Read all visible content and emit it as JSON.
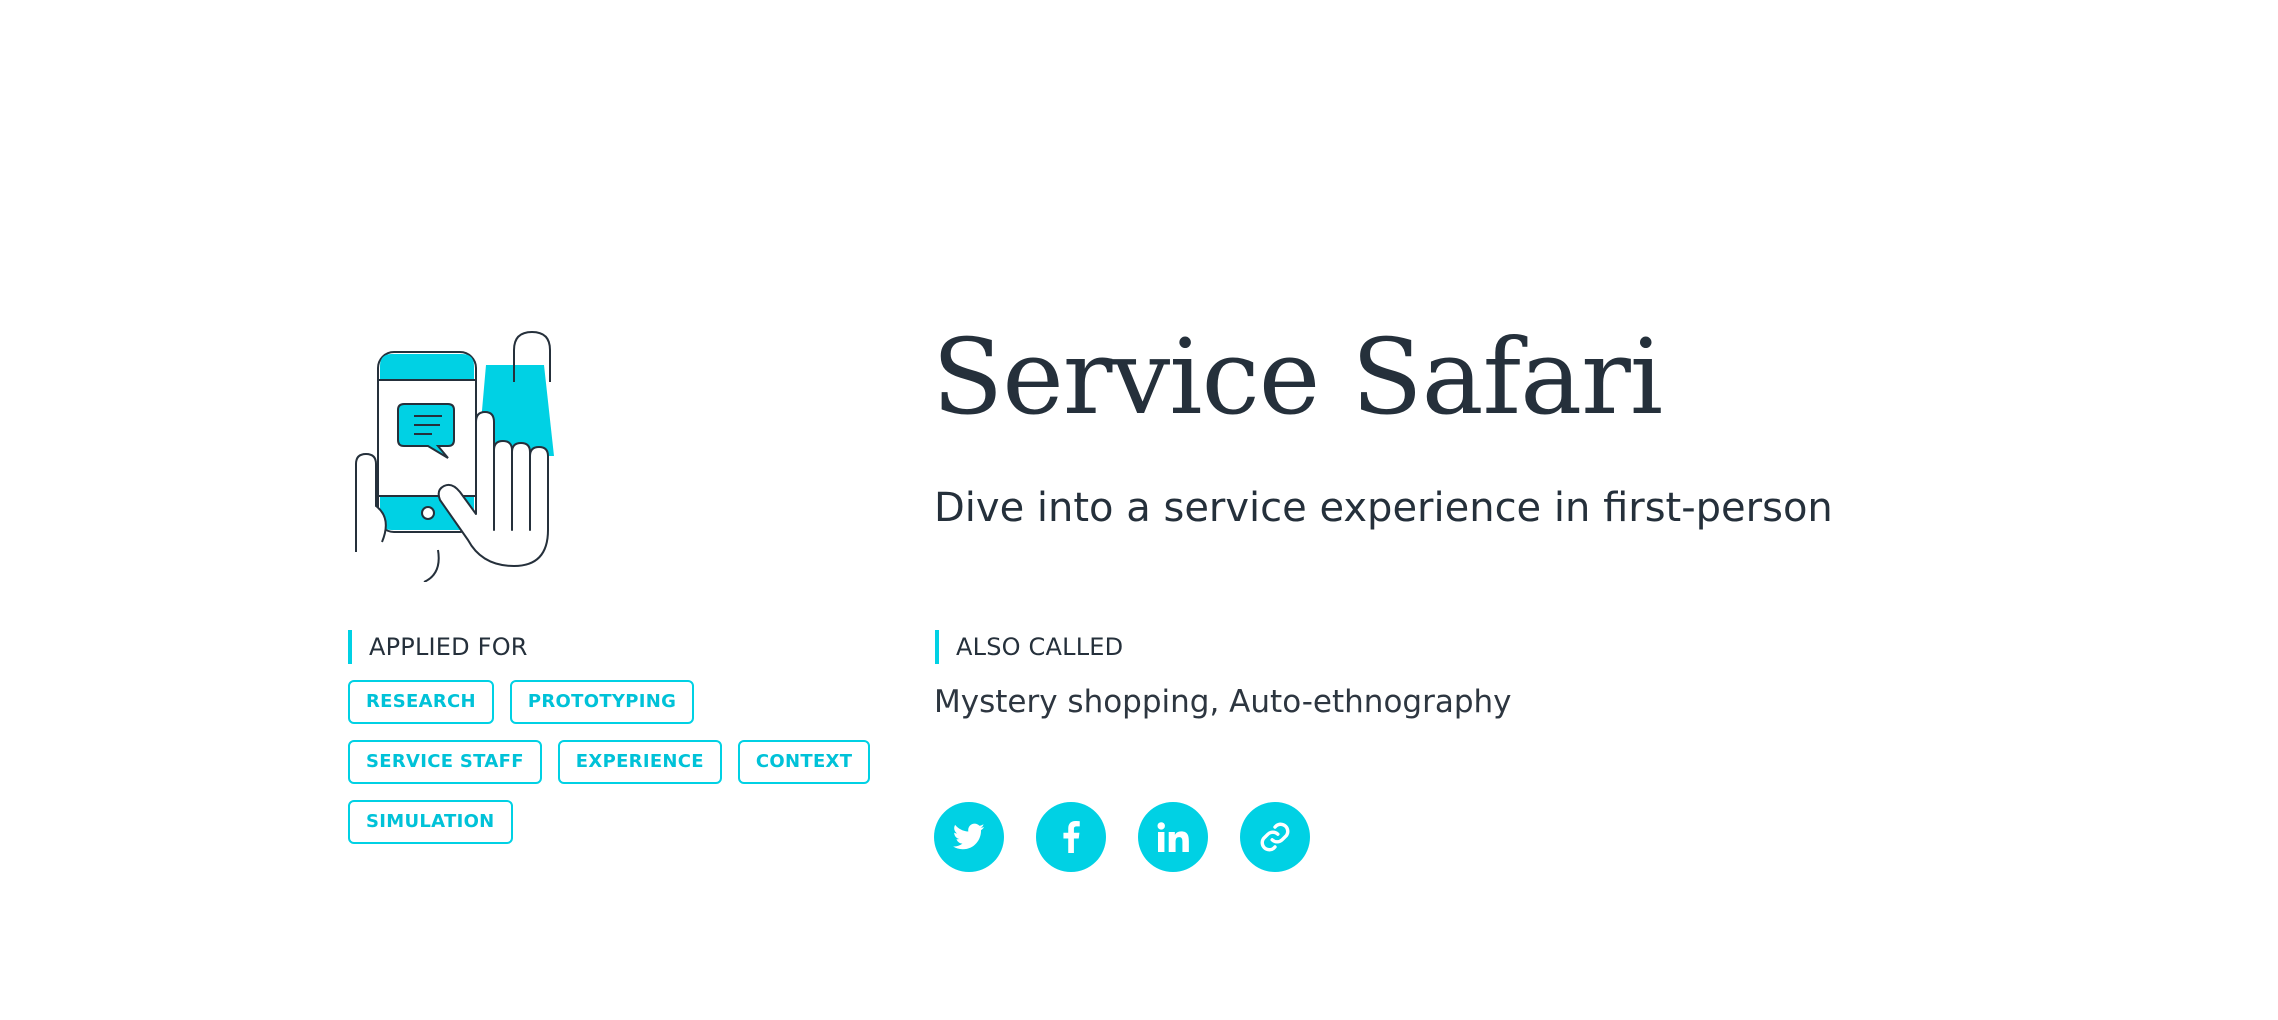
{
  "method": {
    "title": "Service Safari",
    "subtitle": "Dive into a service experience in first-person",
    "illustration_icon": "phone-shopping-hand-icon"
  },
  "applied_for": {
    "label": "APPLIED FOR",
    "tags": [
      "RESEARCH",
      "PROTOTYPING",
      "SERVICE STAFF",
      "EXPERIENCE",
      "CONTEXT",
      "SIMULATION"
    ]
  },
  "also_called": {
    "label": "ALSO CALLED",
    "value": "Mystery shopping, Auto-ethnography"
  },
  "share": {
    "buttons": [
      {
        "icon": "twitter-icon"
      },
      {
        "icon": "facebook-icon"
      },
      {
        "icon": "linkedin-icon"
      },
      {
        "icon": "link-icon"
      }
    ]
  },
  "colors": {
    "accent": "#00d1e4",
    "text": "#25303b",
    "background": "#ffffff"
  }
}
